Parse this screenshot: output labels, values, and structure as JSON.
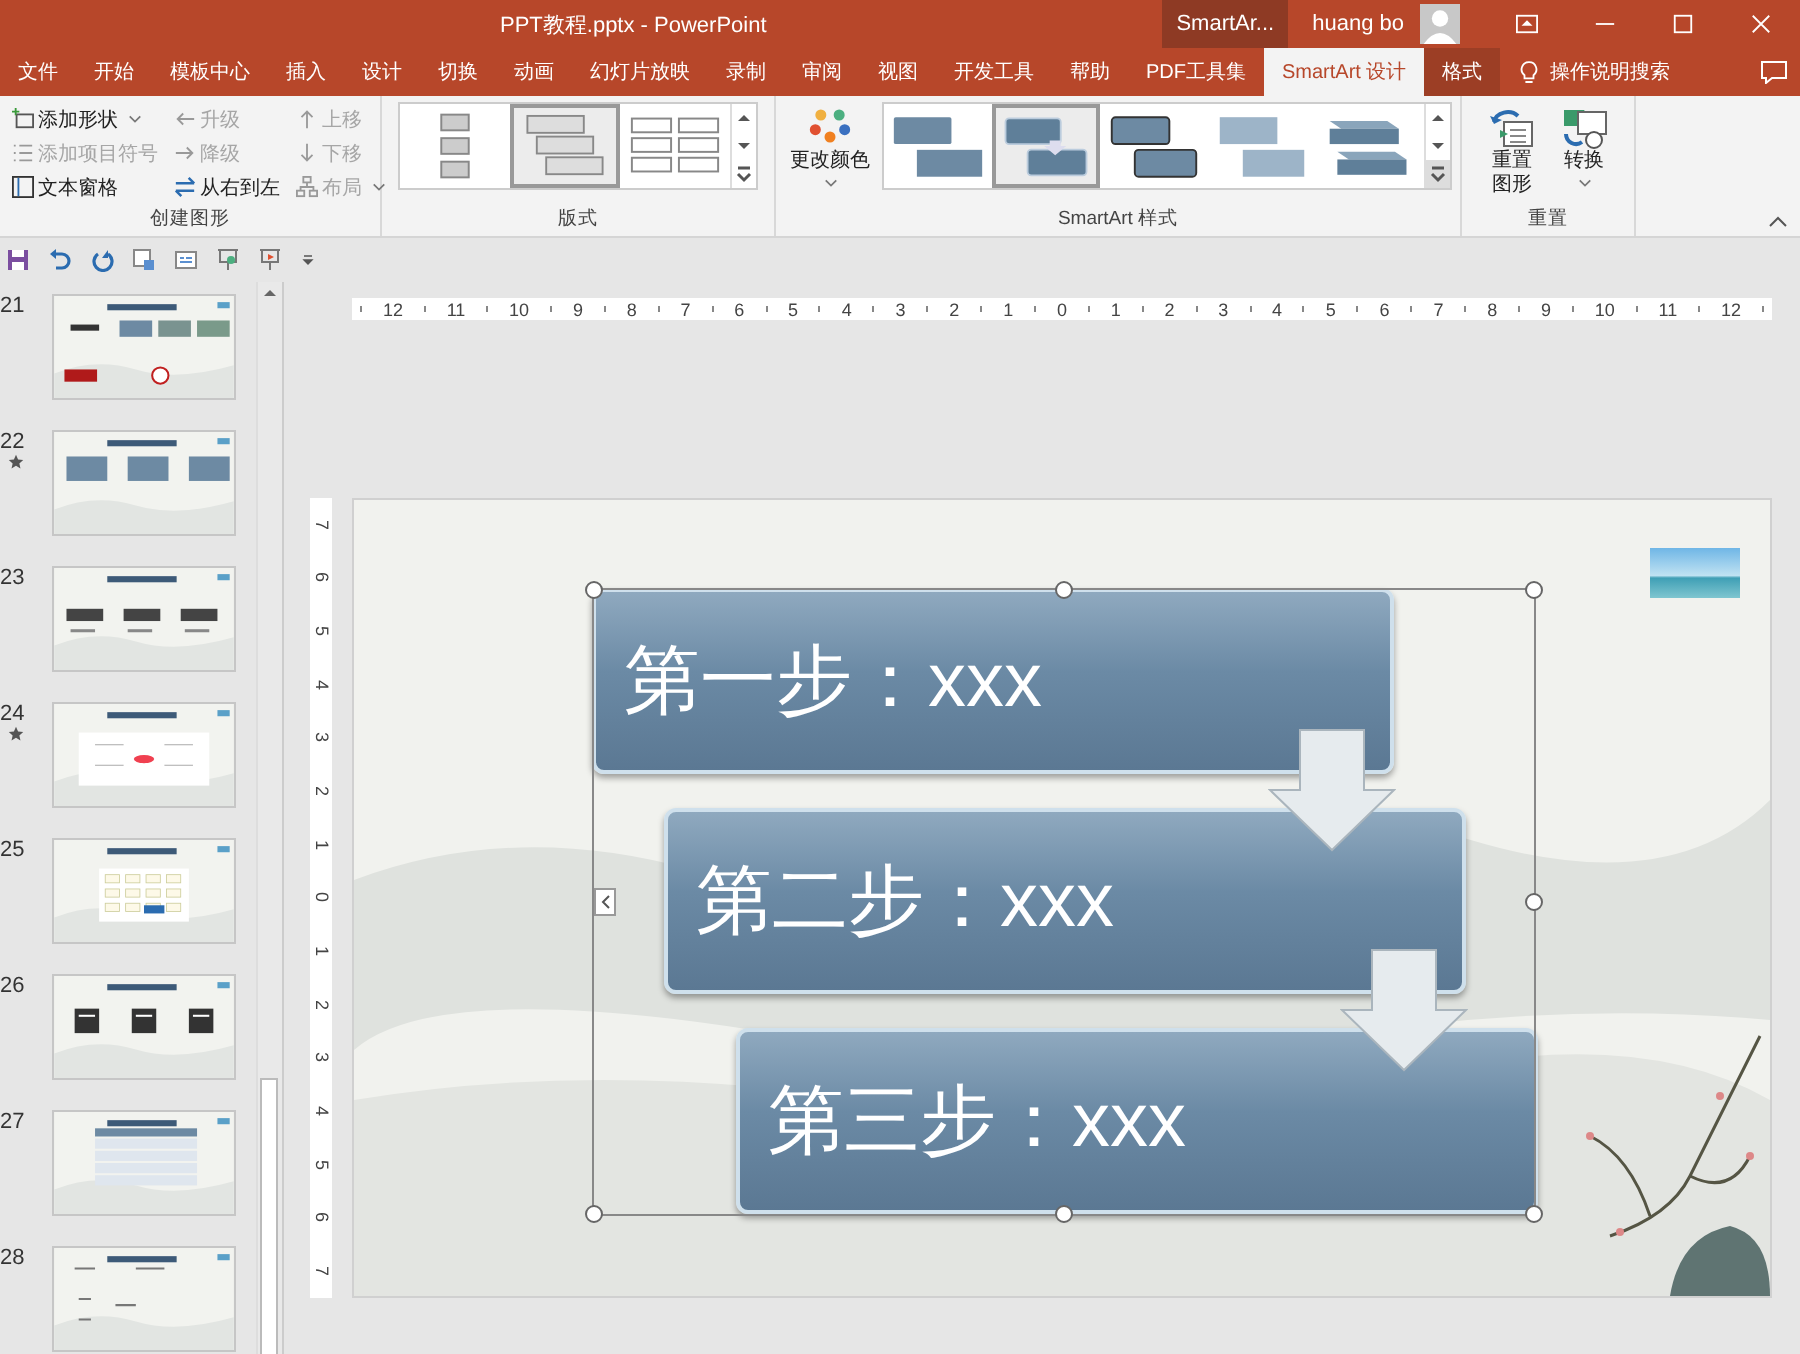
{
  "window": {
    "title": "PPT教程.pptx  -  PowerPoint",
    "context_label": "SmartAr...",
    "user": "huang bo"
  },
  "tabs": [
    {
      "label": "文件",
      "selected": false,
      "kind": "normal"
    },
    {
      "label": "开始",
      "selected": false,
      "kind": "normal"
    },
    {
      "label": "模板中心",
      "selected": false,
      "kind": "normal"
    },
    {
      "label": "插入",
      "selected": false,
      "kind": "normal"
    },
    {
      "label": "设计",
      "selected": false,
      "kind": "normal"
    },
    {
      "label": "切换",
      "selected": false,
      "kind": "normal"
    },
    {
      "label": "动画",
      "selected": false,
      "kind": "normal"
    },
    {
      "label": "幻灯片放映",
      "selected": false,
      "kind": "normal"
    },
    {
      "label": "录制",
      "selected": false,
      "kind": "normal"
    },
    {
      "label": "审阅",
      "selected": false,
      "kind": "normal"
    },
    {
      "label": "视图",
      "selected": false,
      "kind": "normal"
    },
    {
      "label": "开发工具",
      "selected": false,
      "kind": "normal"
    },
    {
      "label": "帮助",
      "selected": false,
      "kind": "normal"
    },
    {
      "label": "PDF工具集",
      "selected": false,
      "kind": "normal"
    },
    {
      "label": "SmartArt 设计",
      "selected": true,
      "kind": "context"
    },
    {
      "label": "格式",
      "selected": false,
      "kind": "context"
    }
  ],
  "search": {
    "label": "操作说明搜索"
  },
  "ribbon": {
    "create": {
      "label": "创建图形",
      "columns": [
        [
          {
            "label": "添加形状",
            "disabled": false,
            "dropdown": true
          },
          {
            "label": "添加项目符号",
            "disabled": true,
            "dropdown": false
          },
          {
            "label": "文本窗格",
            "disabled": false,
            "dropdown": false
          }
        ],
        [
          {
            "label": "升级",
            "disabled": true,
            "dropdown": false
          },
          {
            "label": "降级",
            "disabled": true,
            "dropdown": false
          },
          {
            "label": "从右到左",
            "disabled": false,
            "dropdown": false
          }
        ],
        [
          {
            "label": "上移",
            "disabled": true,
            "dropdown": false
          },
          {
            "label": "下移",
            "disabled": true,
            "dropdown": false
          },
          {
            "label": "布局",
            "disabled": true,
            "dropdown": true
          }
        ]
      ]
    },
    "layouts": {
      "label": "版式",
      "items": [
        {
          "kind": "vertical",
          "selected": false
        },
        {
          "kind": "staggered",
          "selected": true
        },
        {
          "kind": "grid",
          "selected": false
        }
      ]
    },
    "styles": {
      "label": "SmartArt 样式",
      "color_button": "更改颜色",
      "items": [
        {
          "kind": "flat",
          "selected": false
        },
        {
          "kind": "bevel",
          "selected": true
        },
        {
          "kind": "outline",
          "selected": false
        },
        {
          "kind": "light",
          "selected": false
        },
        {
          "kind": "block",
          "selected": false
        }
      ]
    },
    "reset": {
      "label": "重置",
      "buttons": [
        {
          "label": "重置图形",
          "kind": "reset"
        },
        {
          "label": "转换",
          "kind": "convert"
        }
      ]
    }
  },
  "rulers": {
    "horizontal": [
      "12",
      "11",
      "10",
      "9",
      "8",
      "7",
      "6",
      "5",
      "4",
      "3",
      "2",
      "1",
      "0",
      "1",
      "2",
      "3",
      "4",
      "5",
      "6",
      "7",
      "8",
      "9",
      "10",
      "11",
      "12"
    ],
    "vertical": [
      "7",
      "6",
      "5",
      "4",
      "3",
      "2",
      "1",
      "0",
      "1",
      "2",
      "3",
      "4",
      "5",
      "6",
      "7"
    ]
  },
  "slides": [
    {
      "number": "21",
      "animated": false,
      "kind": "images",
      "selected": false
    },
    {
      "number": "22",
      "animated": true,
      "kind": "boxes",
      "selected": false
    },
    {
      "number": "23",
      "animated": false,
      "kind": "barcodes",
      "selected": false
    },
    {
      "number": "24",
      "animated": true,
      "kind": "mindmap",
      "selected": false
    },
    {
      "number": "25",
      "animated": false,
      "kind": "flow",
      "selected": false
    },
    {
      "number": "26",
      "animated": false,
      "kind": "qrcodes",
      "selected": false
    },
    {
      "number": "27",
      "animated": false,
      "kind": "table",
      "selected": false
    },
    {
      "number": "28",
      "animated": false,
      "kind": "diagram",
      "selected": false
    }
  ],
  "smartart": {
    "steps": [
      "第一步：xxx",
      "第二步：xxx",
      "第三步：xxx"
    ]
  }
}
